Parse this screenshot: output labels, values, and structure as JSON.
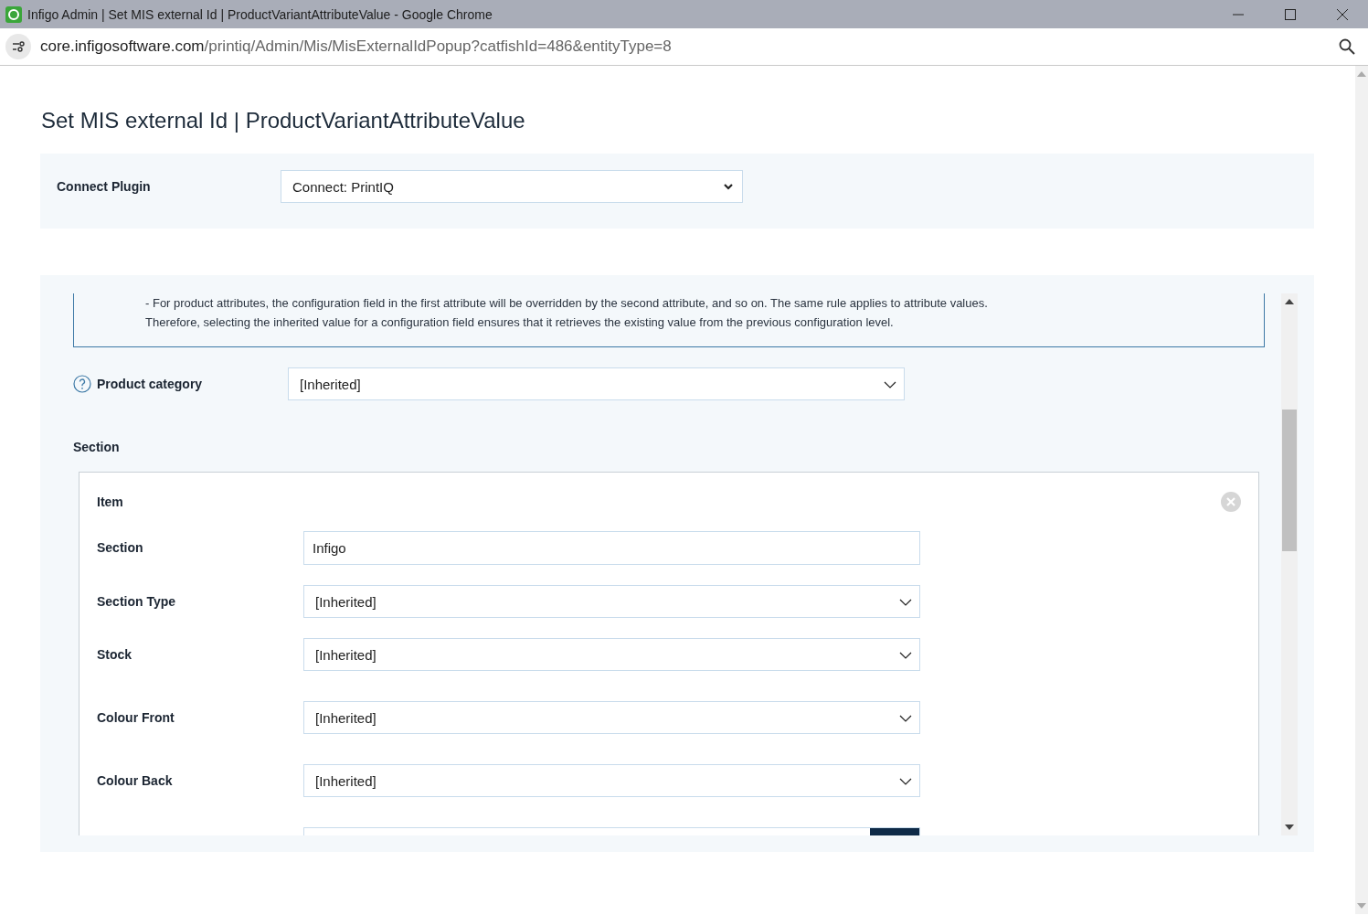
{
  "browser": {
    "title": "Infigo Admin | Set MIS external Id | ProductVariantAttributeValue - Google Chrome",
    "url_host": "core.infigosoftware.com",
    "url_path": "/printiq/Admin/Mis/MisExternalIdPopup?catfishId=486&entityType=8"
  },
  "page_title": "Set MIS external Id | ProductVariantAttributeValue",
  "plugin": {
    "label": "Connect Plugin",
    "value": "Connect: PrintIQ"
  },
  "info_lines": [
    "- For product attributes, the configuration field in the first attribute will be overridden by the second attribute, and so on. The same rule applies to attribute values.",
    "Therefore, selecting the inherited value for a configuration field ensures that it retrieves the existing value from the previous configuration level."
  ],
  "product_category": {
    "label": "Product category",
    "value": "[Inherited]"
  },
  "section_heading": "Section",
  "item": {
    "title": "Item",
    "fields": [
      {
        "label": "Section",
        "kind": "text",
        "value": "Infigo"
      },
      {
        "label": "Section Type",
        "kind": "select",
        "value": "[Inherited]"
      },
      {
        "label": "Stock",
        "kind": "select",
        "value": "[Inherited]"
      },
      {
        "label": "Colour Front",
        "kind": "select",
        "value": "[Inherited]"
      },
      {
        "label": "Colour Back",
        "kind": "select",
        "value": "[Inherited]"
      }
    ]
  }
}
